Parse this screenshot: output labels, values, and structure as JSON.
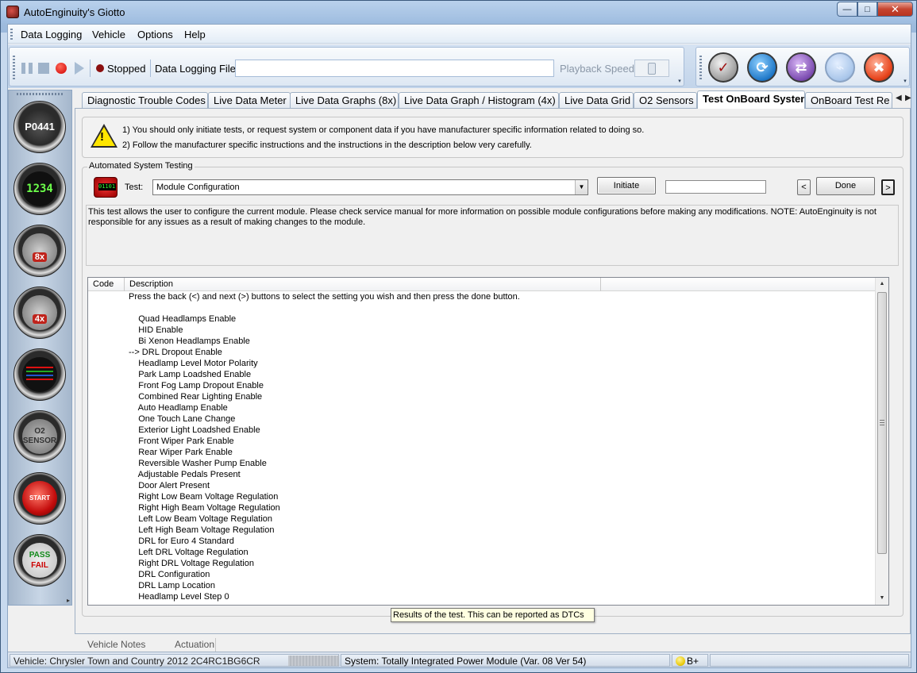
{
  "window": {
    "title": "AutoEnginuity's Giotto",
    "minimize": "—",
    "maximize": "□",
    "close": "✕"
  },
  "menu": [
    "Data Logging",
    "Vehicle",
    "Options",
    "Help"
  ],
  "toolbar": {
    "status": "Stopped",
    "data_logging_file_label": "Data Logging File",
    "data_logging_file_value": "",
    "playback_speed_label": "Playback Speed",
    "dropdown_glyph": "▾",
    "right_icons": [
      "clipboard-icon",
      "refresh-icon",
      "sync-icon",
      "disconnected-icon",
      "exit-icon"
    ]
  },
  "sidebar": {
    "dtc_label": "P0441",
    "meter_label": "1234",
    "graphs8_badge": "8x",
    "graphs4_badge": "4x",
    "o2_label": "O2 SENSOR",
    "start_label": "START",
    "pass_label": "PASS",
    "fail_label": "FAIL"
  },
  "tabs": [
    "Diagnostic Trouble Codes",
    "Live Data Meter",
    "Live Data Graphs (8x)",
    "Live Data Graph / Histogram (4x)",
    "Live Data Grid",
    "O2 Sensors",
    "Test OnBoard System",
    "OnBoard Test Re"
  ],
  "tab_nav": {
    "prev": "◀",
    "next": "▶"
  },
  "warning": {
    "mark": "!",
    "line1": "1) You should only initiate tests, or request system or component data if you have manufacturer specific information related to doing so.",
    "line2": "2) Follow the manufacturer specific instructions and the instructions in the description below very carefully."
  },
  "automated": {
    "group_label": "Automated System Testing",
    "icon_text": "01101",
    "test_label": "Test:",
    "test_value": "Module Configuration",
    "initiate": "Initiate",
    "status_value": "",
    "prev": "<",
    "done": "Done",
    "next": ">",
    "description": "This test allows the user to configure the current module. Please check service manual for more information on possible module configurations before making any modifications. NOTE: AutoEnginuity is not responsible for any issues as a result of making changes to the module."
  },
  "results": {
    "columns": [
      "Code",
      "Description"
    ],
    "rows": [
      "Press the back (<) and next (>) buttons to select the setting you wish and then press the done button.",
      "",
      "    Quad Headlamps Enable",
      "    HID Enable",
      "    Bi Xenon Headlamps Enable",
      "--> DRL Dropout Enable",
      "    Headlamp Level Motor Polarity",
      "    Park Lamp Loadshed Enable",
      "    Front Fog Lamp Dropout Enable",
      "    Combined Rear Lighting Enable",
      "    Auto Headlamp Enable",
      "    One Touch Lane Change",
      "    Exterior Light Loadshed Enable",
      "    Front Wiper Park Enable",
      "    Rear Wiper Park Enable",
      "    Reversible Washer Pump Enable",
      "    Adjustable Pedals Present",
      "    Door Alert Present",
      "    Right Low Beam Voltage Regulation",
      "    Right High Beam Voltage Regulation",
      "    Left Low Beam Voltage Regulation",
      "    Left High Beam Voltage Regulation",
      "    DRL for Euro 4 Standard",
      "    Left DRL Voltage Regulation",
      "    Right DRL Voltage Regulation",
      "    DRL Configuration",
      "    DRL Lamp Location",
      "    Headlamp Level Step 0"
    ],
    "tooltip": "Results of the test. This can be reported as DTCs"
  },
  "bottom_tabs": [
    "Vehicle Notes",
    "Actuation"
  ],
  "statusbar": {
    "vehicle": "Vehicle: Chrysler  Town and Country  2012  2C4RC1BG6CR",
    "system": "System: Totally Integrated Power Module (Var. 08 Ver 54)",
    "battery": "B+"
  }
}
